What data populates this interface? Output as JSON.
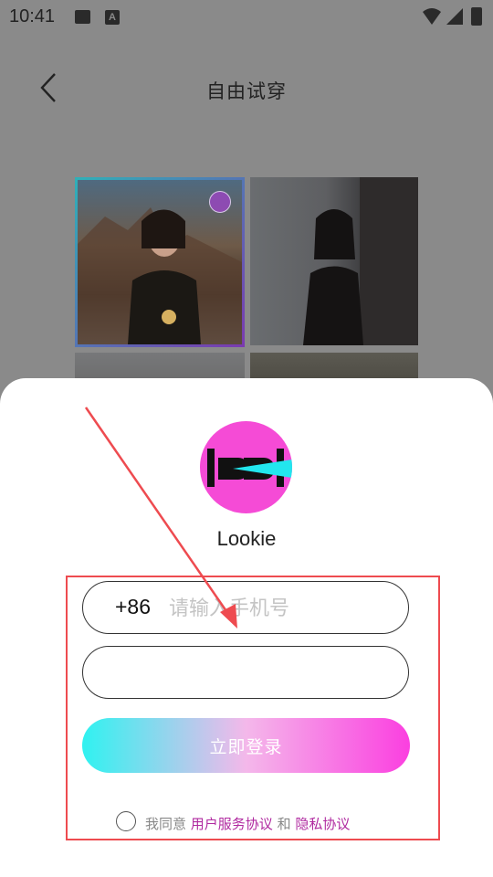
{
  "status_bar": {
    "time": "10:41",
    "font_badge": "A"
  },
  "header": {
    "title": "自由试穿"
  },
  "app": {
    "name": "Lookie",
    "brand_color": "#f54bd6"
  },
  "login": {
    "country_code": "+86",
    "phone_placeholder": "请输入手机号",
    "code_placeholder": "",
    "submit_label": "立即登录",
    "agree_prefix": "我同意",
    "user_agreement": "用户服务协议",
    "and": "和",
    "privacy_policy": "隐私协议"
  },
  "colors": {
    "annotation": "#ee4b50",
    "gradient_start": "#2ff2f0",
    "gradient_end": "#fb3fe0",
    "link": "#b02aa0"
  }
}
